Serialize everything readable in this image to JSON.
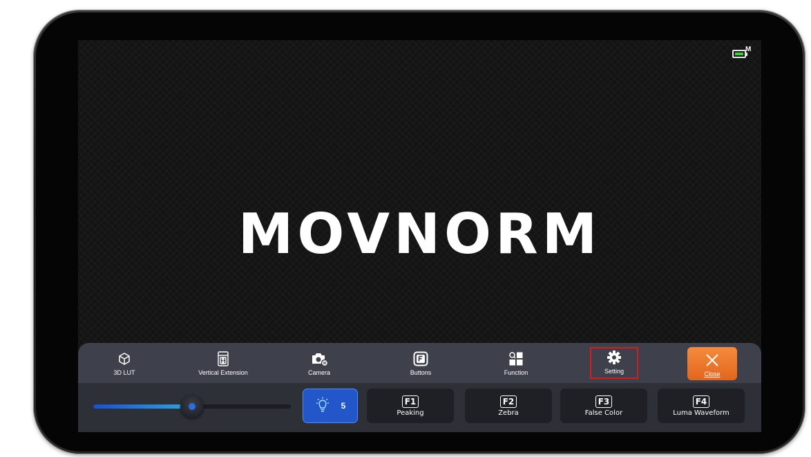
{
  "status": {
    "battery_mode": "M"
  },
  "logo": {
    "text": "MOVNORM"
  },
  "toolbar": {
    "items": [
      {
        "label": "3D LUT",
        "icon": "cube-icon"
      },
      {
        "label": "Vertical Extension",
        "icon": "vertical-extension-icon"
      },
      {
        "label": "Camera",
        "icon": "camera-icon"
      },
      {
        "label": "Buttons",
        "icon": "f-button-icon"
      },
      {
        "label": "Function",
        "icon": "grid-icon"
      },
      {
        "label": "Setting",
        "icon": "gear-icon"
      },
      {
        "label": "Close",
        "icon": "close-icon"
      }
    ]
  },
  "controls": {
    "brightness_slider_fraction": 0.5,
    "brightness_value": "5",
    "function_keys": [
      {
        "key": "F1",
        "label": "Peaking"
      },
      {
        "key": "F2",
        "label": "Zebra"
      },
      {
        "key": "F3",
        "label": "False Color"
      },
      {
        "key": "F4",
        "label": "Luma Waveform"
      }
    ]
  },
  "colors": {
    "accent_blue": "#2356c9",
    "close_orange": "#ee7a2e",
    "highlight_red": "#d41d1d",
    "battery_green": "#3ecf3e"
  }
}
